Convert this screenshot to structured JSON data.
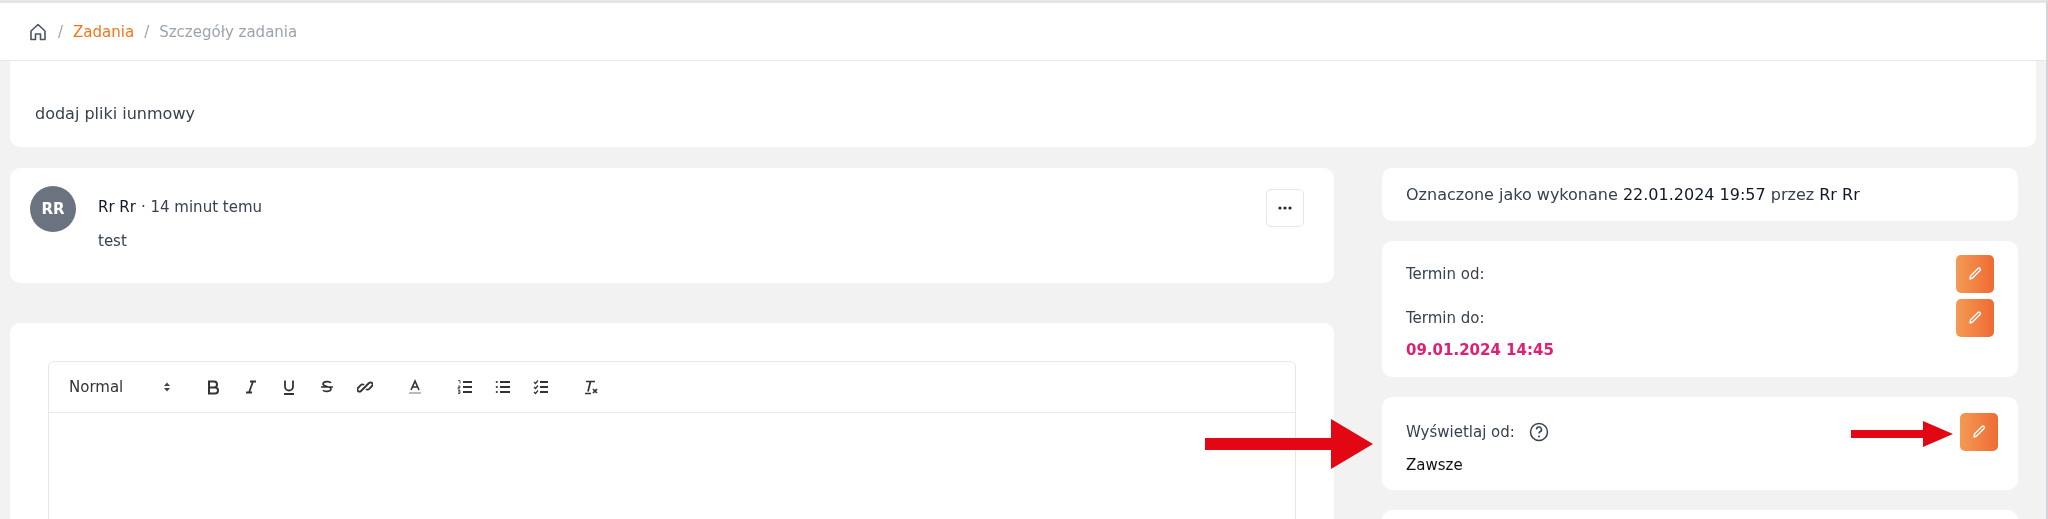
{
  "breadcrumb": [
    {
      "separator": "/",
      "label": "Zadania",
      "kind": "link"
    },
    {
      "separator": "/",
      "label": "Szczegóły zadania",
      "kind": "current"
    }
  ],
  "task": {
    "description": "dodaj pliki iunmowy"
  },
  "comment": {
    "avatar": "RR",
    "author": "Rr Rr",
    "time": "· 14 minut temu",
    "text": "test"
  },
  "editor": {
    "format": "Normal"
  },
  "status": {
    "text": "Oznaczone jako wykonane **22.01.2024 19:57** przez **Rr Rr**"
  },
  "deadlines": [
    {
      "label": "Termin od:"
    },
    {
      "label": "Termin do:",
      "value": "09.01.2024 14:45"
    }
  ],
  "display": {
    "label": "Wyświetlaj od:",
    "value": "Zawsze"
  }
}
